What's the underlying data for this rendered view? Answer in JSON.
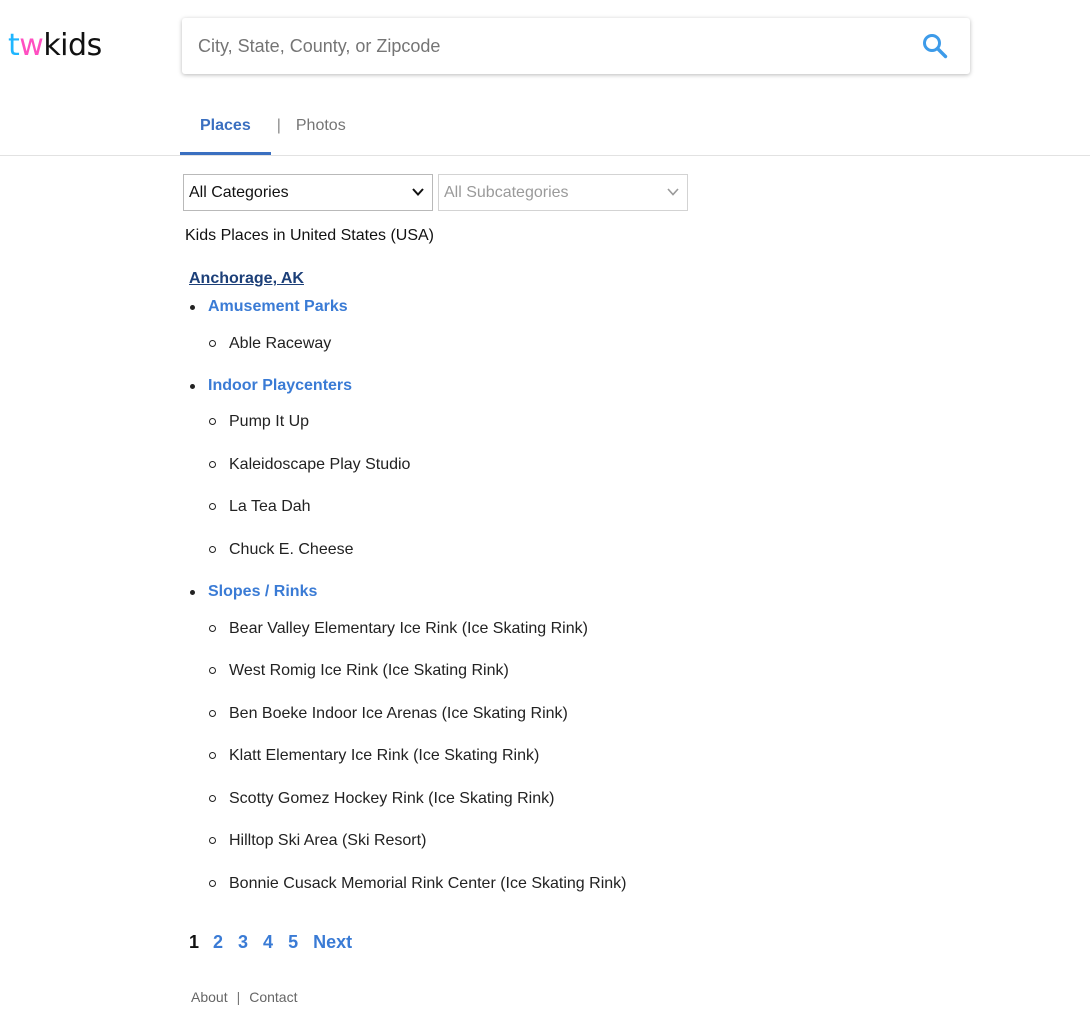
{
  "logo": {
    "part1": "t",
    "part2": "w",
    "part3": "kids",
    "colors": {
      "t": "#1fb6ff",
      "w": "#ff4fc1",
      "kids": "#111111"
    }
  },
  "search": {
    "placeholder": "City, State, County, or Zipcode",
    "value": "",
    "icon": "search-icon",
    "icon_color": "#3d9be9"
  },
  "tabs": [
    {
      "label": "Places",
      "active": true
    },
    {
      "label": "Photos",
      "active": false
    }
  ],
  "tab_separator": "|",
  "filters": {
    "category": "All Categories",
    "subcategory": "All Subcategories"
  },
  "heading": "Kids Places in United States (USA)",
  "city": "Anchorage, AK",
  "categories": [
    {
      "name": "Amusement Parks",
      "items": [
        "Able Raceway"
      ]
    },
    {
      "name": "Indoor Playcenters",
      "items": [
        "Pump It Up",
        "Kaleidoscape Play Studio",
        "La Tea Dah",
        "Chuck E. Cheese"
      ]
    },
    {
      "name": "Slopes / Rinks",
      "items": [
        "Bear Valley Elementary Ice Rink (Ice Skating Rink)",
        "West Romig Ice Rink (Ice Skating Rink)",
        "Ben Boeke Indoor Ice Arenas (Ice Skating Rink)",
        "Klatt Elementary Ice Rink (Ice Skating Rink)",
        "Scotty Gomez Hockey Rink (Ice Skating Rink)",
        "Hilltop Ski Area (Ski Resort)",
        "Bonnie Cusack Memorial Rink Center (Ice Skating Rink)"
      ]
    }
  ],
  "pagination": {
    "current": "1",
    "pages": [
      "2",
      "3",
      "4",
      "5"
    ],
    "next": "Next"
  },
  "footer": {
    "about": "About",
    "separator": "|",
    "contact": "Contact"
  },
  "accent_color": "#3a7bd5"
}
